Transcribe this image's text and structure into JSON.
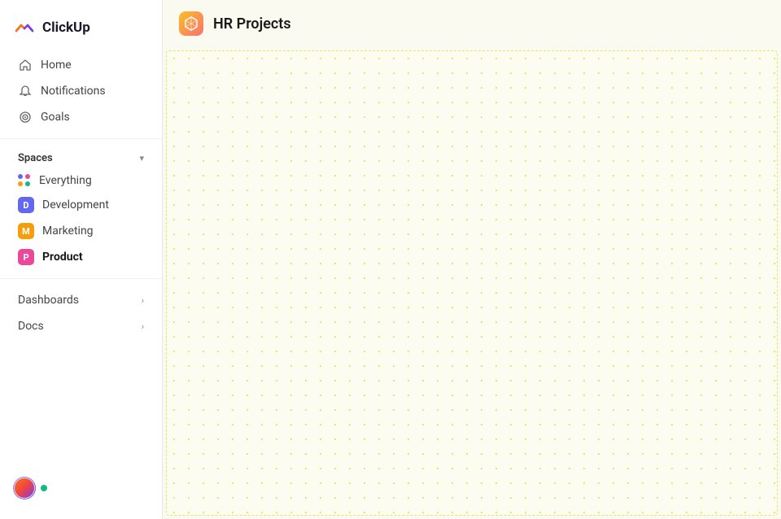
{
  "logo": {
    "text": "ClickUp"
  },
  "nav": {
    "home_label": "Home",
    "notifications_label": "Notifications",
    "goals_label": "Goals"
  },
  "spaces": {
    "section_label": "Spaces",
    "items": [
      {
        "id": "everything",
        "label": "Everything",
        "type": "dots"
      },
      {
        "id": "development",
        "label": "Development",
        "type": "badge",
        "badge_letter": "D",
        "badge_color": "#6366f1"
      },
      {
        "id": "marketing",
        "label": "Marketing",
        "type": "badge",
        "badge_letter": "M",
        "badge_color": "#f59e0b"
      },
      {
        "id": "product",
        "label": "Product",
        "type": "badge",
        "badge_letter": "P",
        "badge_color": "#ec4899",
        "active": true
      }
    ]
  },
  "expandable": [
    {
      "id": "dashboards",
      "label": "Dashboards"
    },
    {
      "id": "docs",
      "label": "Docs"
    }
  ],
  "page": {
    "title": "HR Projects",
    "icon": "📦"
  },
  "footer": {
    "status": "online"
  }
}
